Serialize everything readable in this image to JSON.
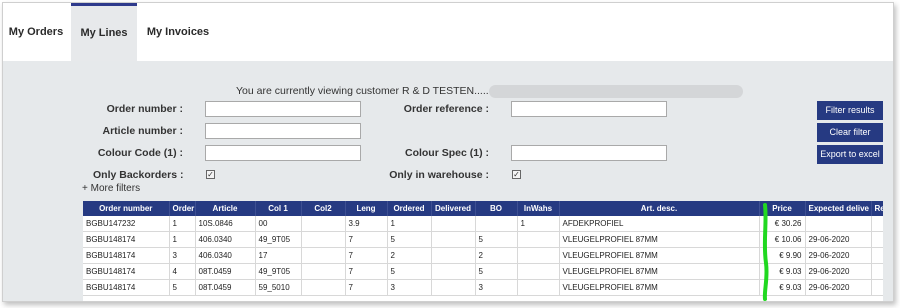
{
  "tabs": [
    {
      "label": "My Orders",
      "active": false
    },
    {
      "label": "My Lines",
      "active": true
    },
    {
      "label": "My Invoices",
      "active": false
    }
  ],
  "customer_notice": "You are currently viewing customer R & D TESTEN.........",
  "filters": {
    "order_number": {
      "label": "Order number :",
      "value": ""
    },
    "order_reference": {
      "label": "Order reference :",
      "value": ""
    },
    "article_number": {
      "label": "Article number :",
      "value": ""
    },
    "colour_code": {
      "label": "Colour Code (1) :",
      "value": ""
    },
    "colour_spec": {
      "label": "Colour Spec (1) :",
      "value": ""
    },
    "only_backorders": {
      "label": "Only Backorders :",
      "checked": true
    },
    "only_in_warehouse": {
      "label": "Only in warehouse :",
      "checked": true
    },
    "more_filters": "+ More filters"
  },
  "buttons": {
    "filter_results": "Filter results",
    "clear_filter": "Clear filter",
    "export_to_excel": "Export to excel"
  },
  "accent_color": "#263a82",
  "table": {
    "headers": [
      "Order number",
      "Order",
      "Article",
      "Col 1",
      "Col2",
      "Leng",
      "Ordered",
      "Delivered",
      "BO",
      "InWahs",
      "Art. desc.",
      "Price",
      "Expected delive",
      "Re"
    ],
    "rows": [
      [
        "BGBU147232",
        "1",
        "10S.0846",
        "00",
        "",
        "3.9",
        "1",
        "",
        "",
        "1",
        "AFDEKPROFIEL",
        "€ 30.26",
        "",
        ""
      ],
      [
        "BGBU148174",
        "1",
        "406.0340",
        "49_9T05",
        "",
        "7",
        "5",
        "",
        "5",
        "",
        "VLEUGELPROFIEL 87MM",
        "€ 10.06",
        "29-06-2020",
        ""
      ],
      [
        "BGBU148174",
        "3",
        "406.0340",
        "17",
        "",
        "7",
        "2",
        "",
        "2",
        "",
        "VLEUGELPROFIEL 87MM",
        "€ 9.90",
        "29-06-2020",
        ""
      ],
      [
        "BGBU148174",
        "4",
        "08T.0459",
        "49_9T05",
        "",
        "7",
        "5",
        "",
        "5",
        "",
        "VLEUGELPROFIEL 87MM",
        "€ 9.03",
        "29-06-2020",
        ""
      ],
      [
        "BGBU148174",
        "5",
        "08T.0459",
        "59_5010",
        "",
        "7",
        "3",
        "",
        "3",
        "",
        "VLEUGELPROFIEL 87MM",
        "€ 9.03",
        "29-06-2020",
        ""
      ]
    ]
  }
}
